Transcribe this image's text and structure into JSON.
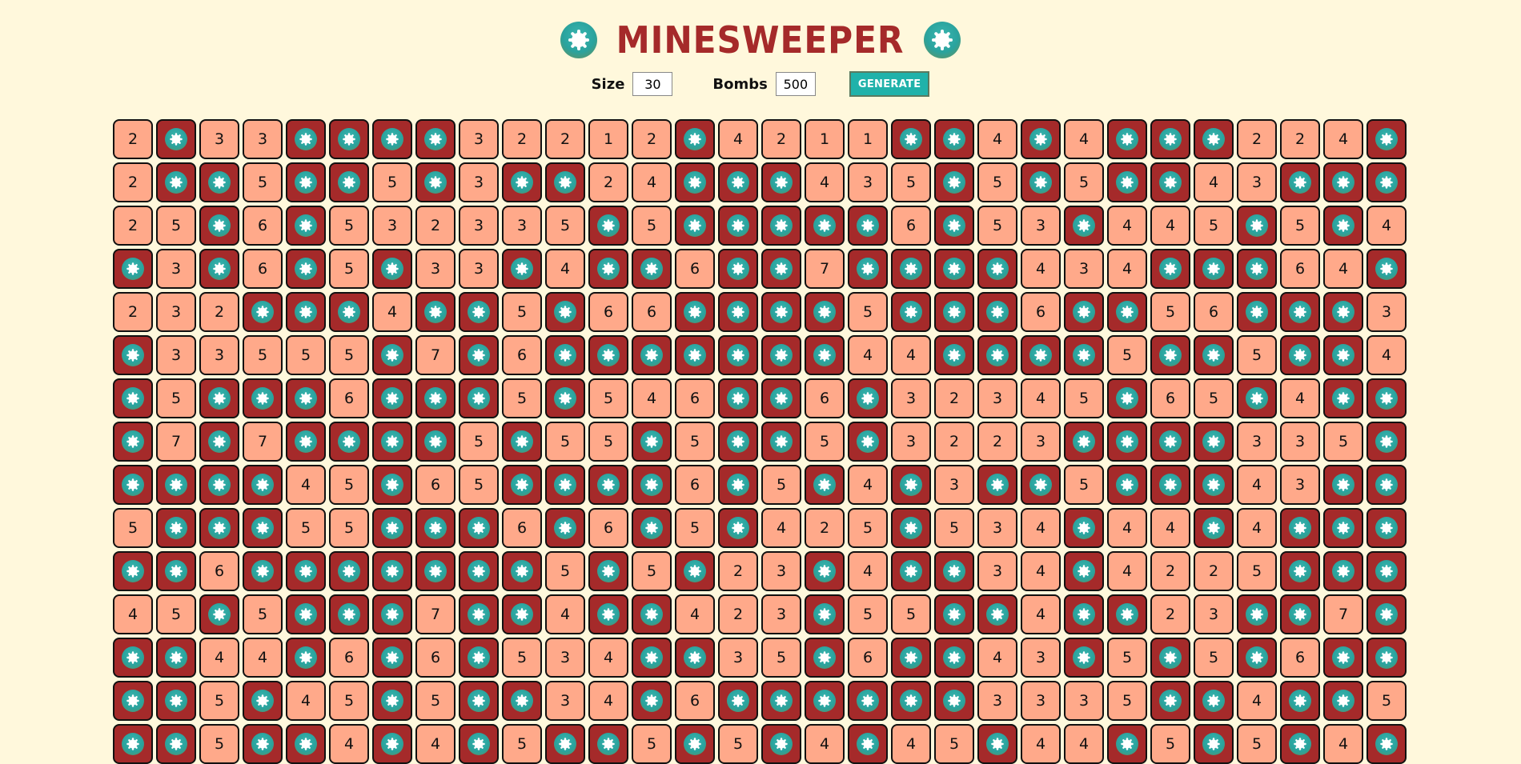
{
  "header": {
    "title": "MINESWEEPER",
    "logo_icon": "mine-icon"
  },
  "controls": {
    "size_label": "Size",
    "size_value": "30",
    "bombs_label": "Bombs",
    "bombs_value": "500",
    "generate_label": "GENERATE"
  },
  "colors": {
    "background": "#fff8dc",
    "title": "#a52a2a",
    "number_cell": "#ffa98a",
    "bomb_cell": "#a52a2a",
    "mine": "#2aa39e",
    "button": "#20b2aa"
  },
  "board": {
    "cell_icon": "mine-icon",
    "rows": [
      [
        "2",
        "B",
        "3",
        "3",
        "B",
        "B",
        "B",
        "B",
        "3",
        "2",
        "2",
        "1",
        "2",
        "B",
        "4",
        "2",
        "1",
        "1",
        "B",
        "B",
        "4",
        "B",
        "4",
        "B",
        "B",
        "B",
        "2",
        "2",
        "4",
        "B"
      ],
      [
        "2",
        "B",
        "B",
        "5",
        "B",
        "B",
        "5",
        "B",
        "3",
        "B",
        "B",
        "2",
        "4",
        "B",
        "B",
        "B",
        "4",
        "3",
        "5",
        "B",
        "5",
        "B",
        "5",
        "B",
        "B",
        "4",
        "3",
        "B",
        "B",
        "B"
      ],
      [
        "2",
        "5",
        "B",
        "6",
        "B",
        "5",
        "3",
        "2",
        "3",
        "3",
        "5",
        "B",
        "5",
        "B",
        "B",
        "B",
        "B",
        "B",
        "6",
        "B",
        "5",
        "3",
        "B",
        "4",
        "4",
        "5",
        "B",
        "5",
        "B",
        "4"
      ],
      [
        "B",
        "3",
        "B",
        "6",
        "B",
        "5",
        "B",
        "3",
        "3",
        "B",
        "4",
        "B",
        "B",
        "6",
        "B",
        "B",
        "7",
        "B",
        "B",
        "B",
        "B",
        "4",
        "3",
        "4",
        "B",
        "B",
        "B",
        "6",
        "4",
        "B"
      ],
      [
        "2",
        "3",
        "2",
        "B",
        "B",
        "B",
        "4",
        "B",
        "B",
        "5",
        "B",
        "6",
        "6",
        "B",
        "B",
        "B",
        "B",
        "5",
        "B",
        "B",
        "B",
        "6",
        "B",
        "B",
        "5",
        "6",
        "B",
        "B",
        "B",
        "3"
      ],
      [
        "B",
        "3",
        "3",
        "5",
        "5",
        "5",
        "B",
        "7",
        "B",
        "6",
        "B",
        "B",
        "B",
        "B",
        "B",
        "B",
        "B",
        "4",
        "4",
        "B",
        "B",
        "B",
        "B",
        "5",
        "B",
        "B",
        "5",
        "B",
        "B",
        "4"
      ],
      [
        "B",
        "5",
        "B",
        "B",
        "B",
        "6",
        "B",
        "B",
        "B",
        "5",
        "B",
        "5",
        "4",
        "6",
        "B",
        "B",
        "6",
        "B",
        "3",
        "2",
        "3",
        "4",
        "5",
        "B",
        "6",
        "5",
        "B",
        "4",
        "B",
        "B"
      ],
      [
        "B",
        "7",
        "B",
        "7",
        "B",
        "B",
        "B",
        "B",
        "5",
        "B",
        "5",
        "5",
        "B",
        "5",
        "B",
        "B",
        "5",
        "B",
        "3",
        "2",
        "2",
        "3",
        "B",
        "B",
        "B",
        "B",
        "3",
        "3",
        "5",
        "B"
      ],
      [
        "B",
        "B",
        "B",
        "B",
        "4",
        "5",
        "B",
        "6",
        "5",
        "B",
        "B",
        "B",
        "B",
        "6",
        "B",
        "5",
        "B",
        "4",
        "B",
        "3",
        "B",
        "B",
        "5",
        "B",
        "B",
        "B",
        "4",
        "3",
        "B",
        "B"
      ],
      [
        "5",
        "B",
        "B",
        "B",
        "5",
        "5",
        "B",
        "B",
        "B",
        "6",
        "B",
        "6",
        "B",
        "5",
        "B",
        "4",
        "2",
        "5",
        "B",
        "5",
        "3",
        "4",
        "B",
        "4",
        "4",
        "B",
        "4",
        "B",
        "B",
        "B"
      ],
      [
        "B",
        "B",
        "6",
        "B",
        "B",
        "B",
        "B",
        "B",
        "B",
        "B",
        "5",
        "B",
        "5",
        "B",
        "2",
        "3",
        "B",
        "4",
        "B",
        "B",
        "3",
        "4",
        "B",
        "4",
        "2",
        "2",
        "5",
        "B",
        "B",
        "B"
      ],
      [
        "4",
        "5",
        "B",
        "5",
        "B",
        "B",
        "B",
        "7",
        "B",
        "B",
        "4",
        "B",
        "B",
        "4",
        "2",
        "3",
        "B",
        "5",
        "5",
        "B",
        "B",
        "4",
        "B",
        "B",
        "2",
        "3",
        "B",
        "B",
        "7",
        "B"
      ],
      [
        "B",
        "B",
        "4",
        "4",
        "B",
        "6",
        "B",
        "6",
        "B",
        "5",
        "3",
        "4",
        "B",
        "B",
        "3",
        "5",
        "B",
        "6",
        "B",
        "B",
        "4",
        "3",
        "B",
        "5",
        "B",
        "5",
        "B",
        "6",
        "B",
        "B"
      ],
      [
        "B",
        "B",
        "5",
        "B",
        "4",
        "5",
        "B",
        "5",
        "B",
        "B",
        "3",
        "4",
        "B",
        "6",
        "B",
        "B",
        "B",
        "B",
        "B",
        "B",
        "3",
        "3",
        "3",
        "5",
        "B",
        "B",
        "4",
        "B",
        "B",
        "5"
      ],
      [
        "B",
        "B",
        "5",
        "B",
        "B",
        "4",
        "B",
        "4",
        "B",
        "5",
        "B",
        "B",
        "5",
        "B",
        "5",
        "B",
        "4",
        "B",
        "4",
        "5",
        "B",
        "4",
        "4",
        "B",
        "5",
        "B",
        "5",
        "B",
        "4",
        "B"
      ]
    ]
  }
}
